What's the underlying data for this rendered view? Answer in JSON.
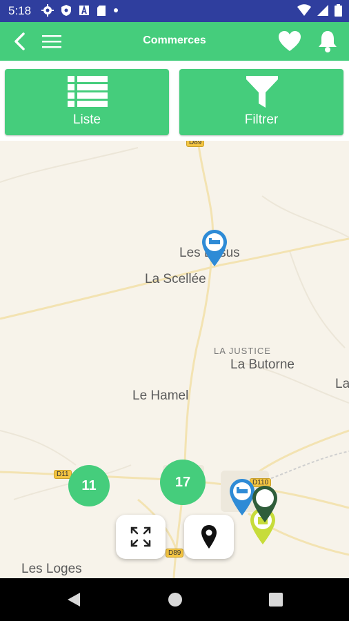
{
  "status_bar": {
    "time": "5:18"
  },
  "app_bar": {
    "title": "Commerces"
  },
  "actions": {
    "list_label": "Liste",
    "filter_label": "Filtrer"
  },
  "map": {
    "places": {
      "les_sus": "Les Essus",
      "la_scellee": "La Scellée",
      "la_justice": "LA JUSTICE",
      "la_butorne": "La Butorne",
      "la_edge": "La",
      "le_hamel": "Le Hamel",
      "les_loges": "Les Loges"
    },
    "roads": {
      "d89_top": "D89",
      "d11": "D11",
      "d89_bottom": "D89",
      "d110": "D110"
    },
    "clusters": {
      "left": "11",
      "right": "17"
    }
  },
  "colors": {
    "accent": "#45cd7c",
    "status_bar": "#2f3e9e",
    "pin_blue": "#2e8bd6",
    "pin_dark": "#2f5d3a",
    "pin_yellow": "#c7dc3a"
  }
}
